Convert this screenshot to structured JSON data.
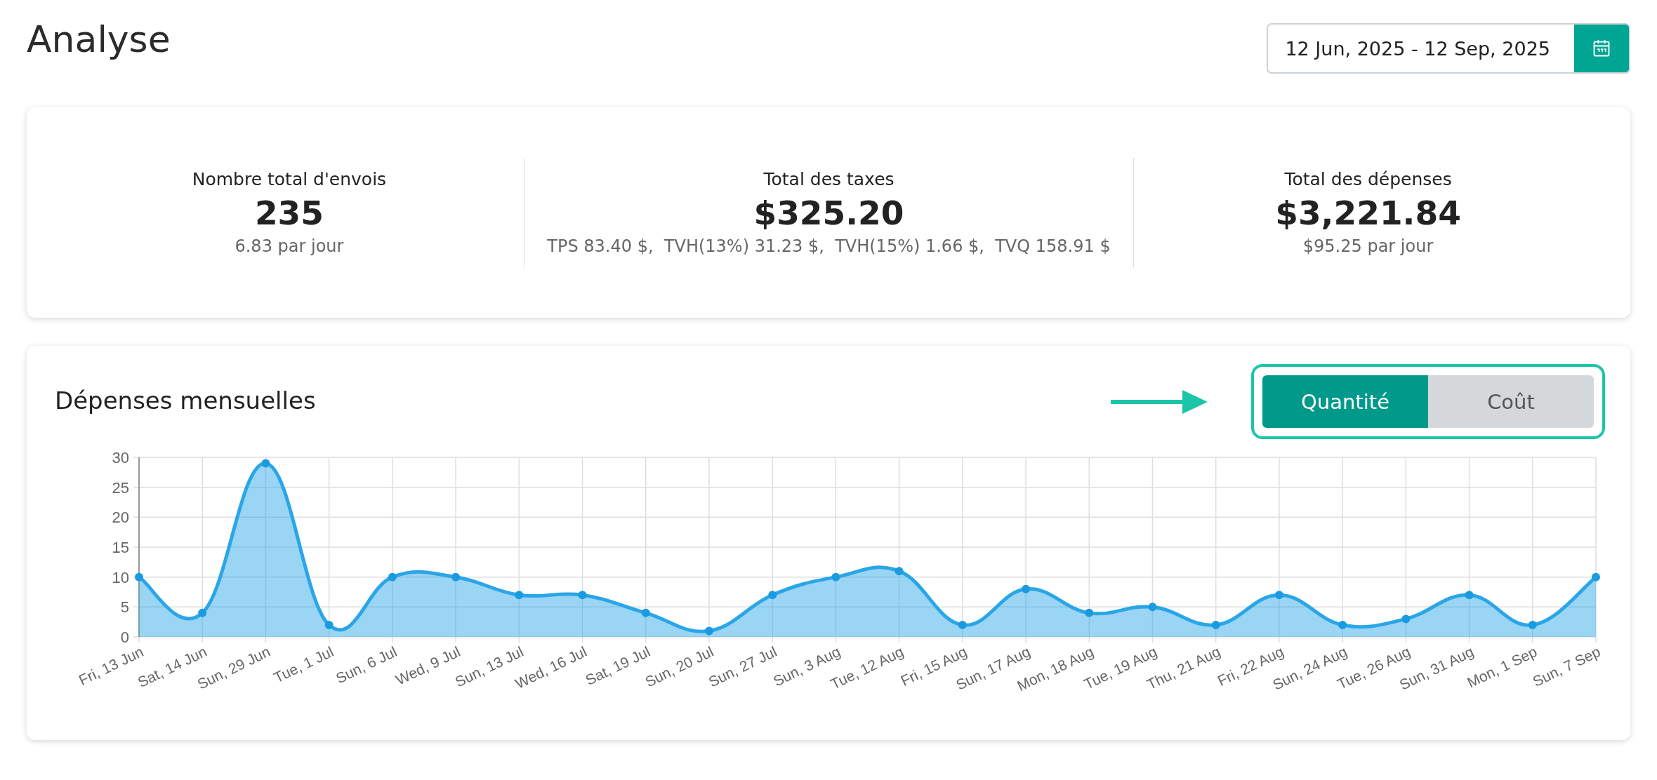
{
  "page": {
    "title": "Analyse"
  },
  "date_range": {
    "value": "12 Jun, 2025 - 12 Sep, 2025"
  },
  "stats": [
    {
      "label": "Nombre total d'envois",
      "value": "235",
      "sub": "6.83 par jour"
    },
    {
      "label": "Total des taxes",
      "value": "$325.20",
      "sub": "TPS 83.40 $,  TVH(13%) 31.23 $,  TVH(15%) 1.66 $,  TVQ 158.91 $"
    },
    {
      "label": "Total des dépenses",
      "value": "$3,221.84",
      "sub": "$95.25 par jour"
    }
  ],
  "monthly": {
    "title": "Dépenses mensuelles",
    "toggle": [
      {
        "label": "Quantité",
        "selected": true
      },
      {
        "label": "Coût",
        "selected": false
      }
    ],
    "chart_data": {
      "type": "area",
      "categories": [
        "Fri, 13 Jun",
        "Sat, 14 Jun",
        "Sun, 29 Jun",
        "Tue, 1 Jul",
        "Sun, 6 Jul",
        "Wed, 9 Jul",
        "Sun, 13 Jul",
        "Wed, 16 Jul",
        "Sat, 19 Jul",
        "Sun, 20 Jul",
        "Sun, 27 Jul",
        "Sun, 3 Aug",
        "Tue, 12 Aug",
        "Fri, 15 Aug",
        "Sun, 17 Aug",
        "Mon, 18 Aug",
        "Tue, 19 Aug",
        "Thu, 21 Aug",
        "Fri, 22 Aug",
        "Sun, 24 Aug",
        "Tue, 26 Aug",
        "Sun, 31 Aug",
        "Mon, 1 Sep",
        "Sun, 7 Sep"
      ],
      "grid": true,
      "series": [
        {
          "color": "#2aa6e8",
          "values": [
            10,
            4,
            29,
            2,
            10,
            10,
            7,
            7,
            4,
            1,
            7,
            10,
            11,
            2,
            8,
            4,
            5,
            2,
            7,
            2,
            3,
            7,
            2,
            10
          ]
        }
      ],
      "ylim": [
        0,
        30
      ],
      "yticks": [
        0,
        5,
        10,
        15,
        20,
        25,
        30
      ]
    }
  }
}
